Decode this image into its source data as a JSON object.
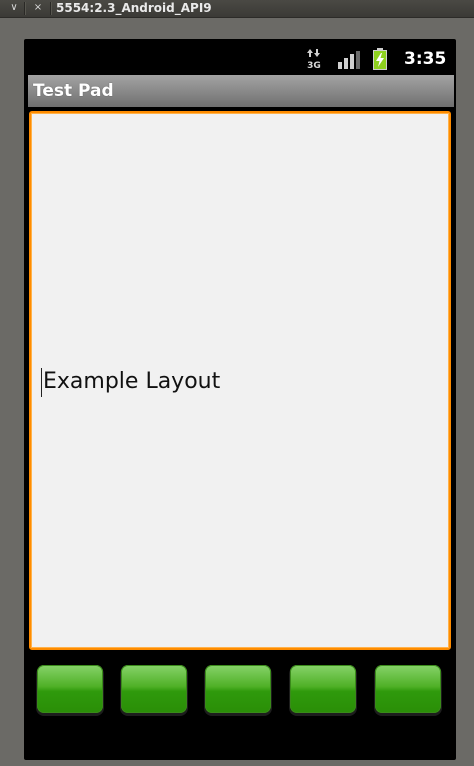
{
  "window": {
    "menu_glyph": "∨",
    "close_glyph": "×",
    "title": "5554:2.3_Android_API9"
  },
  "status_bar": {
    "network_label": "3G",
    "time": "3:35",
    "icons": [
      "data-transfer-3g-icon",
      "signal-strength-icon",
      "battery-charging-icon"
    ],
    "battery_color": "#8ed11f"
  },
  "app": {
    "title": "Test Pad"
  },
  "editor": {
    "text": "Example Layout",
    "focus_border_color": "#ff8c00"
  },
  "buttons": {
    "count": 5,
    "color": "#3aa312"
  }
}
